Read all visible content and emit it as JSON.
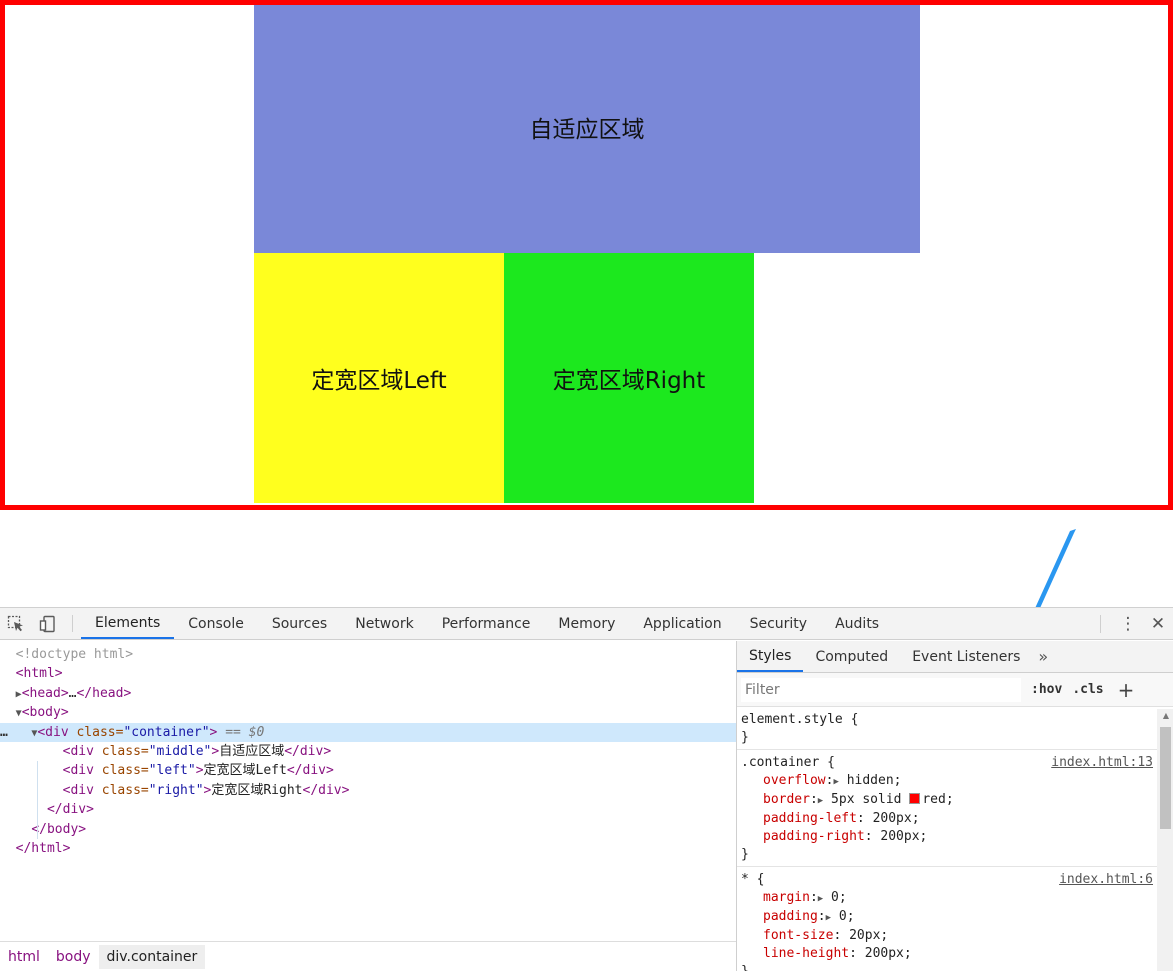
{
  "preview": {
    "middle_text": "自适应区域",
    "left_text": "定宽区域Left",
    "right_text": "定宽区域Right",
    "colors": {
      "border": "#ff0000",
      "middle": "#7a88d8",
      "left": "#ffff1e",
      "right": "#1ce81e"
    }
  },
  "annotation": {
    "arrow_color": "#2a97f0"
  },
  "devtools": {
    "tabs": [
      "Elements",
      "Console",
      "Sources",
      "Network",
      "Performance",
      "Memory",
      "Application",
      "Security",
      "Audits"
    ],
    "active_tab": "Elements",
    "icons": {
      "inspect": "inspect-cursor-icon",
      "device": "device-toggle-icon",
      "menu": "kebab-menu-icon",
      "close": "close-icon"
    },
    "dom": {
      "doctype": "<!doctype html>",
      "html_open": "<html>",
      "head_open": "<head>",
      "head_ellipsis": "…",
      "head_close": "</head>",
      "body_open": "<body>",
      "container_open_tag": "<div",
      "container_attr": " class=",
      "container_value": "\"container\"",
      "container_close_angle": ">",
      "selected_marker": " == $0",
      "children": [
        {
          "open": "<div",
          "attr": " class=",
          "value": "\"middle\"",
          "gt": ">",
          "text": "自适应区域",
          "close": "</div>"
        },
        {
          "open": "<div",
          "attr": " class=",
          "value": "\"left\"",
          "gt": ">",
          "text": "定宽区域Left",
          "close": "</div>"
        },
        {
          "open": "<div",
          "attr": " class=",
          "value": "\"right\"",
          "gt": ">",
          "text": "定宽区域Right",
          "close": "</div>"
        }
      ],
      "div_close": "</div>",
      "body_close": "</body>",
      "html_close": "</html>",
      "row_ellipsis": "…"
    },
    "breadcrumb": [
      "html",
      "body",
      "div.container"
    ],
    "styles": {
      "subtabs": [
        "Styles",
        "Computed",
        "Event Listeners"
      ],
      "active_subtab": "Styles",
      "filter_placeholder": "Filter",
      "hov": ":hov",
      "cls": ".cls",
      "plus": "+",
      "rules": [
        {
          "selector": "element.style",
          "source": "",
          "declarations": []
        },
        {
          "selector": ".container",
          "source": "index.html:13",
          "declarations": [
            {
              "name": "overflow",
              "value": "hidden",
              "expandable": true,
              "swatch": false
            },
            {
              "name": "border",
              "value_before": "5px solid ",
              "value_after": "red",
              "expandable": true,
              "swatch": true
            },
            {
              "name": "padding-left",
              "value": "200px",
              "expandable": false,
              "swatch": false
            },
            {
              "name": "padding-right",
              "value": "200px",
              "expandable": false,
              "swatch": false
            }
          ]
        },
        {
          "selector": "*",
          "source": "index.html:6",
          "declarations": [
            {
              "name": "margin",
              "value": "0",
              "expandable": true,
              "swatch": false
            },
            {
              "name": "padding",
              "value": "0",
              "expandable": true,
              "swatch": false
            },
            {
              "name": "font-size",
              "value": "20px",
              "expandable": false,
              "swatch": false
            },
            {
              "name": "line-height",
              "value": "200px",
              "expandable": false,
              "swatch": false
            }
          ]
        }
      ]
    }
  }
}
